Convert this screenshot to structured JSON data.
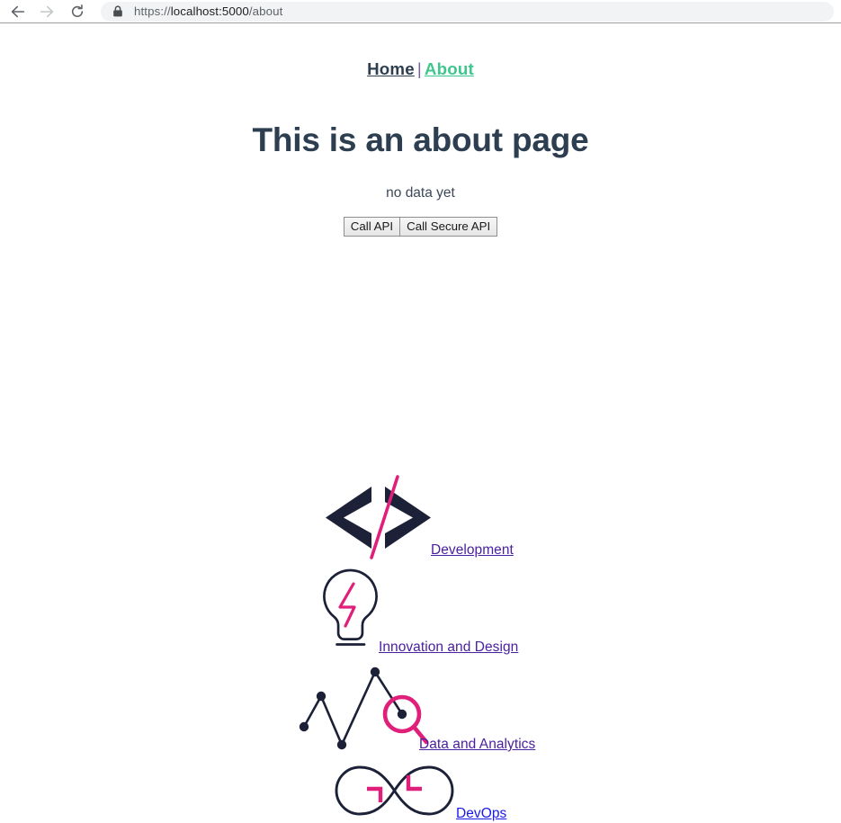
{
  "browser": {
    "back_icon": "back-arrow-icon",
    "forward_icon": "forward-arrow-icon",
    "reload_icon": "reload-icon",
    "lock_icon": "lock-icon",
    "url_scheme": "https://",
    "url_host": "localhost:5000",
    "url_path": "/about",
    "url_full": "https://localhost:5000/about"
  },
  "nav": {
    "home_label": "Home",
    "separator": "|",
    "about_label": "About",
    "home_color": "#2c3e50",
    "about_color": "#3ec78c"
  },
  "main": {
    "title": "This is an about page",
    "status": "no data yet",
    "call_api_label": "Call API",
    "call_secure_api_label": "Call Secure API"
  },
  "services": [
    {
      "icon": "code-brackets-icon",
      "label": "Development",
      "link_color": "#4a20a0"
    },
    {
      "icon": "lightbulb-icon",
      "label": "Innovation and Design",
      "link_color": "#4a20a0"
    },
    {
      "icon": "line-chart-magnifier-icon",
      "label": "Data and Analytics",
      "link_color": "#4a20a0"
    },
    {
      "icon": "infinity-loop-icon",
      "label": "DevOps",
      "link_color": "#1a1ae8"
    }
  ],
  "colors": {
    "icon_dark": "#1c2138",
    "icon_pink": "#e01f7a",
    "heading": "#2c3e50",
    "accent_green": "#3ec78c",
    "chrome_bg": "#f1f3f4"
  }
}
